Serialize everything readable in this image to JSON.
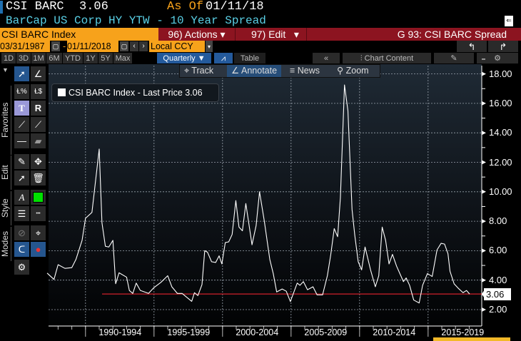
{
  "header": {
    "ticker": "CSI BARC",
    "price": "3.06",
    "as_of_label": "As Of",
    "as_of_date": "01/11/18",
    "description": "BarCap US Corp HY YTW - 10 Year Spread"
  },
  "menu": {
    "security": "CSI BARC Index",
    "actions": "96) Actions",
    "edit": "97) Edit",
    "chart_name": "G 93: CSI BARC Spread"
  },
  "dates": {
    "start": "03/31/1987",
    "sep": "-",
    "end": "01/11/2018",
    "currency": "Local CCY"
  },
  "toolbar": {
    "ranges": [
      "1D",
      "3D",
      "1M",
      "6M",
      "YTD",
      "1Y",
      "5Y",
      "Max"
    ],
    "period": "Quarterly ▼",
    "table": "Table",
    "collapse": "«",
    "chart_content": "Chart Content"
  },
  "subtoolbar": {
    "track": "Track",
    "annotate": "Annotate",
    "news": "News",
    "zoom": "Zoom"
  },
  "side_tabs": [
    "Favorites",
    "Edit",
    "Style",
    "Modes"
  ],
  "colors": {
    "line": "#ffffff",
    "ref_line": "#d0202a",
    "style_swatch": "#00e000"
  },
  "chart_data": {
    "type": "line",
    "legend": "CSI BARC Index - Last Price 3.06",
    "last_value_label": "3.06",
    "reference_line": 3.06,
    "ylim": [
      1,
      19
    ],
    "xlim": [
      1987.25,
      2018.03
    ],
    "yticks": [
      "2.00",
      "4.00",
      "6.00",
      "8.00",
      "10.00",
      "12.00",
      "14.00",
      "16.00",
      "18.00"
    ],
    "ytick_values": [
      2,
      4,
      6,
      8,
      10,
      12,
      14,
      16,
      18
    ],
    "xtick_labels": [
      "1990-1994",
      "1995-1999",
      "2000-2004",
      "2005-2009",
      "2010-2014",
      "2015-2019"
    ],
    "xtick_starts": [
      1990,
      1995,
      2000,
      2005,
      2010,
      2015
    ],
    "series": [
      {
        "name": "CSI BARC Index",
        "x": [
          1987.2,
          1987.7,
          1988.0,
          1988.5,
          1989.0,
          1989.3,
          1989.75,
          1990.0,
          1990.47,
          1991.0,
          1991.2,
          1991.45,
          1991.7,
          1992.0,
          1992.2,
          1992.45,
          1993.0,
          1993.2,
          1993.45,
          1993.7,
          1994.0,
          1994.6,
          1995.0,
          1995.5,
          1996.0,
          1996.3,
          1996.7,
          1997.05,
          1997.75,
          1997.95,
          1998.2,
          1998.5,
          1998.7,
          1998.9,
          1999.2,
          1999.5,
          1999.75,
          1999.95,
          2000.2,
          2000.45,
          2000.7,
          2000.97,
          2001.2,
          2001.45,
          2001.7,
          2002.15,
          2002.45,
          2002.7,
          2003.05,
          2003.45,
          2003.7,
          2003.95,
          2004.35,
          2004.65,
          2004.95,
          2005.45,
          2005.65,
          2005.9,
          2006.2,
          2006.6,
          2006.9,
          2007.3,
          2007.65,
          2007.9,
          2008.15,
          2008.4,
          2008.6,
          2008.9,
          2009.15,
          2009.45,
          2009.65,
          2009.9,
          2010.15,
          2010.4,
          2010.8,
          2011.15,
          2011.4,
          2011.65,
          2011.9,
          2012.15,
          2012.4,
          2012.7,
          2013.2,
          2013.4,
          2013.65,
          2013.95,
          2014.35,
          2014.6,
          2014.95,
          2015.3,
          2015.65,
          2015.95,
          2016.2,
          2016.45,
          2016.6,
          2016.9,
          2017.2,
          2017.55,
          2017.8,
          2018.03
        ],
        "values": [
          4.48,
          4.05,
          5.05,
          4.8,
          4.85,
          5.4,
          6.7,
          8.2,
          8.6,
          12.9,
          7.9,
          6.3,
          6.25,
          6.7,
          3.76,
          4.5,
          4.2,
          3.3,
          3.1,
          3.8,
          3.3,
          3.1,
          3.5,
          3.85,
          4.3,
          3.55,
          3.1,
          3.1,
          2.56,
          3.15,
          2.95,
          3.7,
          6.0,
          5.9,
          5.25,
          5.2,
          5.65,
          5.1,
          6.55,
          6.6,
          7.1,
          9.4,
          7.6,
          7.35,
          9.2,
          6.4,
          7.7,
          10.0,
          8.0,
          5.4,
          4.45,
          3.2,
          3.4,
          3.25,
          2.55,
          3.8,
          3.65,
          3.9,
          3.35,
          3.55,
          3.0,
          3.0,
          4.3,
          5.75,
          7.5,
          6.95,
          9.6,
          17.25,
          15.5,
          8.8,
          7.05,
          5.25,
          4.7,
          6.25,
          4.7,
          3.55,
          4.3,
          7.6,
          6.7,
          5.1,
          5.75,
          4.95,
          3.9,
          4.15,
          3.65,
          2.65,
          2.45,
          3.65,
          4.45,
          4.25,
          6.05,
          6.5,
          6.45,
          5.8,
          4.6,
          3.75,
          3.45,
          3.15,
          3.3,
          3.06
        ]
      }
    ]
  }
}
